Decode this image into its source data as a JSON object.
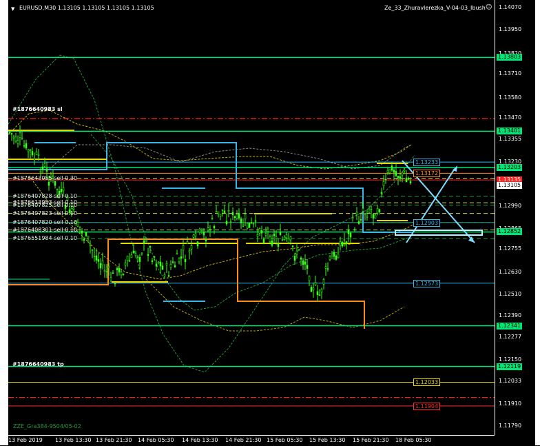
{
  "chart_window": {
    "title": "EURUSD,M30  1.13105 1.13105 1.13105 1.13105",
    "indicator_label": "Ze_33_Zhuravlerezka_V-04-03_Ibush",
    "smiley_icon": "smiley-icon",
    "bottom_left_text": "ZZE_Gra384-9504/05-02"
  },
  "chart_data": {
    "type": "candlestick",
    "symbol": "EURUSD",
    "timeframe": "M30",
    "ylim": [
      1.1175,
      1.1407
    ],
    "y_ticks": [
      "1.14070",
      "1.13950",
      "1.13820",
      "1.13710",
      "1.13580",
      "1.13470",
      "1.13355",
      "1.13230",
      "1.13105",
      "1.12990",
      "1.12865",
      "1.12755",
      "1.12630",
      "1.12510",
      "1.12390",
      "1.12277",
      "1.12150",
      "1.12033",
      "1.11910",
      "1.11790"
    ],
    "x_ticks": [
      "13 Feb 2019",
      "13 Feb 13:30",
      "13 Feb 21:30",
      "14 Feb 05:30",
      "14 Feb 13:30",
      "14 Feb 21:30",
      "15 Feb 05:30",
      "15 Feb 13:30",
      "15 Feb 21:30",
      "18 Feb 05:30"
    ],
    "current_price": "1.13105",
    "current_price_red": "1.13135",
    "horizontal_lines": [
      {
        "price": 1.13803,
        "label": "1.13803",
        "color": "#00e676"
      },
      {
        "price": 1.13401,
        "label": "1.13401",
        "color": "#00e676"
      },
      {
        "price": 1.13203,
        "label": "1.13203",
        "color": "#00e676"
      },
      {
        "price": 1.12852,
        "label": "1.12852",
        "color": "#00e676"
      },
      {
        "price": 1.12341,
        "label": "1.12341",
        "color": "#00e676"
      },
      {
        "price": 1.12119,
        "label": "1.12119",
        "color": "#00e676"
      }
    ],
    "boxed_levels": [
      {
        "price": 1.13233,
        "label": "1.13233",
        "color": "#38b6e8"
      },
      {
        "price": 1.13172,
        "label": "1.13172",
        "color": "#ff8c1a"
      },
      {
        "price": 1.12903,
        "label": "1.12903",
        "color": "#38b6e8"
      },
      {
        "price": 1.12573,
        "label": "1.12573",
        "color": "#38b6e8"
      },
      {
        "price": 1.12033,
        "label": "1.12033",
        "color": "#e6d800"
      },
      {
        "price": 1.11904,
        "label": "1.11904",
        "color": "#ff2a2a"
      }
    ],
    "order_labels": [
      {
        "text": "#1876640983 sl",
        "price": 1.13519
      },
      {
        "text": "#1876643055 sell 0.30",
        "price": 1.13145
      },
      {
        "text": "#1876407828 sell 0.10",
        "price": 1.13047
      },
      {
        "text": "#1876613953 sell 0.10",
        "price": 1.13011
      },
      {
        "text": "#1876407825 sell 0.10",
        "price": 1.12998
      },
      {
        "text": "#1876407823 sell 0.10",
        "price": 1.12953
      },
      {
        "text": "#1876407820 sell 0.10",
        "price": 1.12903
      },
      {
        "text": "#1876408301 sell 0.10",
        "price": 1.12863
      },
      {
        "text": "#1876551984 sell 0.10",
        "price": 1.12816
      },
      {
        "text": "#1876640983 tp",
        "price": 1.12128
      }
    ]
  }
}
